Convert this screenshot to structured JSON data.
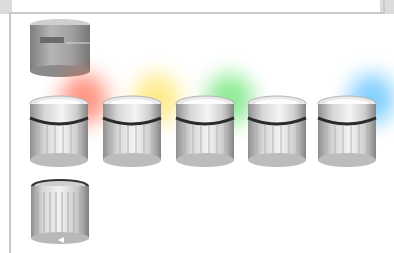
{
  "image": {
    "description_free": true
  },
  "modules": {
    "base": {
      "icon": "signal-tower-base-icon",
      "color": "#9a9a9a"
    },
    "lights": [
      {
        "name": "red",
        "glow": "#ff5a3c"
      },
      {
        "name": "yellow",
        "glow": "#ffe04a"
      },
      {
        "name": "green",
        "glow": "#4fe05a"
      },
      {
        "name": "white",
        "glow": "#ffffff"
      },
      {
        "name": "blue",
        "glow": "#3fb5ff"
      }
    ],
    "clear": {
      "icon": "clear-lens-module-icon"
    }
  }
}
